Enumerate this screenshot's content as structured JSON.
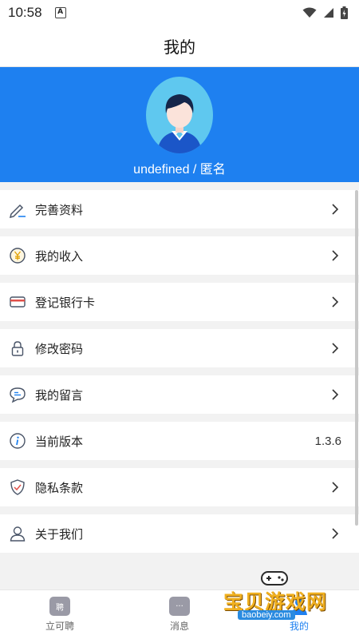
{
  "status_bar": {
    "time": "10:58",
    "a_icon": "A"
  },
  "header": {
    "title": "我的"
  },
  "profile": {
    "username": "undefined / 匿名",
    "avatar": "avatar-icon"
  },
  "menu": [
    {
      "label": "完善资料",
      "icon": "pencil-icon",
      "right": ""
    },
    {
      "label": "我的收入",
      "icon": "yen-coin-icon",
      "right": ""
    },
    {
      "label": "登记银行卡",
      "icon": "card-icon",
      "right": ""
    },
    {
      "label": "修改密码",
      "icon": "lock-icon",
      "right": ""
    },
    {
      "label": "我的留言",
      "icon": "message-icon",
      "right": ""
    },
    {
      "label": "当前版本",
      "icon": "info-icon",
      "right": "1.3.6"
    },
    {
      "label": "隐私条款",
      "icon": "shield-icon",
      "right": ""
    },
    {
      "label": "关于我们",
      "icon": "user-icon",
      "right": ""
    }
  ],
  "tabs": [
    {
      "label": "立可聘",
      "icon_text": "聘",
      "active": false
    },
    {
      "label": "消息",
      "icon_text": "···",
      "active": false
    },
    {
      "label": "我的",
      "icon_text": "",
      "active": true
    }
  ],
  "watermark": {
    "text": "宝贝游戏网",
    "url": "baobeiy.com"
  },
  "colors": {
    "primary": "#1e80f0",
    "avatar_bg": "#5fc8ef"
  }
}
